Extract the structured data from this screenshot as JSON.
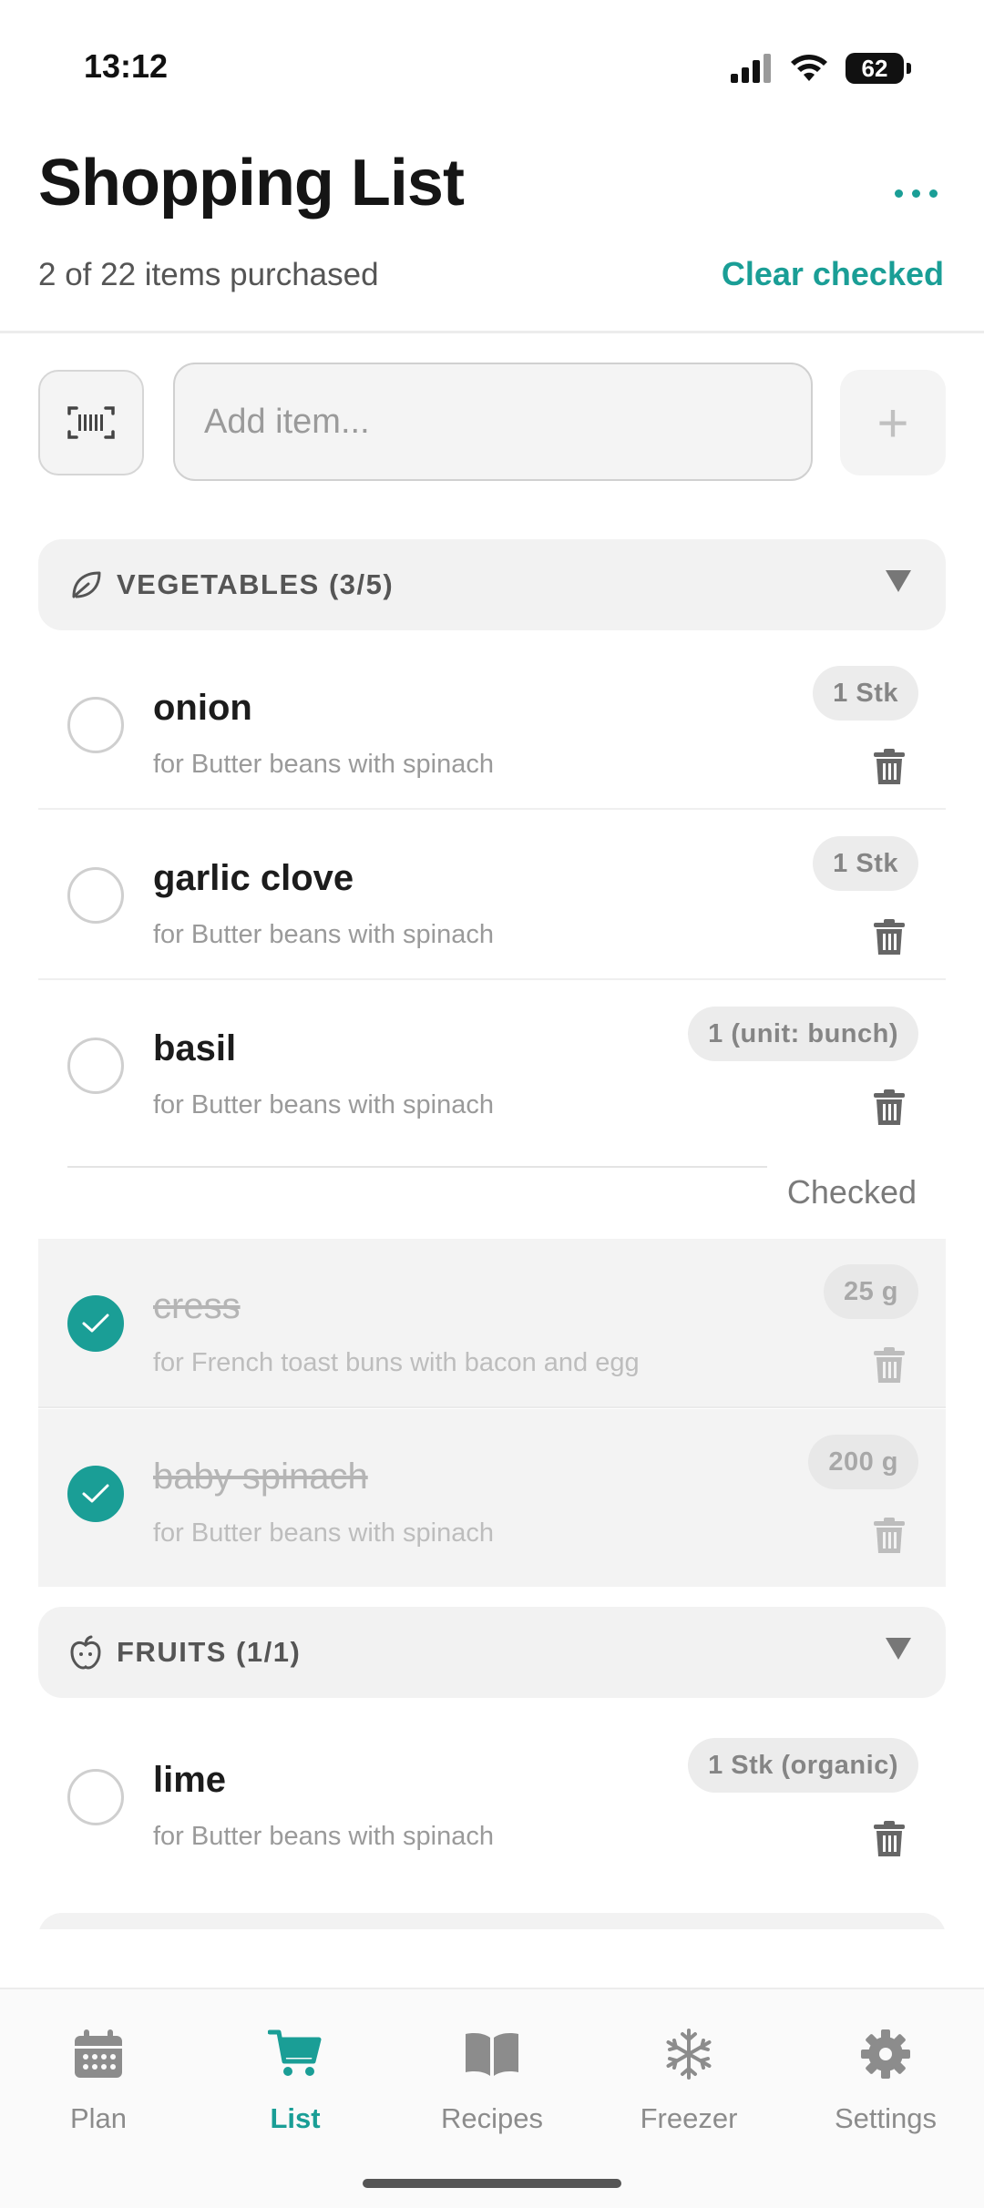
{
  "status_bar": {
    "time": "13:12",
    "battery": "62"
  },
  "header": {
    "title": "Shopping List",
    "subtitle": "2 of 22 items purchased",
    "clear_label": "Clear checked"
  },
  "add_item": {
    "placeholder": "Add item...",
    "add_symbol": "+"
  },
  "categories": [
    {
      "label": "VEGETABLES (3/5)",
      "icon": "leaf-icon",
      "items": [
        {
          "name": "onion",
          "note": "for Butter beans with spinach",
          "qty": "1 Stk",
          "checked": false
        },
        {
          "name": "garlic clove",
          "note": "for Butter beans with spinach",
          "qty": "1 Stk",
          "checked": false
        },
        {
          "name": "basil",
          "note": "for Butter beans with spinach",
          "qty": "1 (unit: bunch)",
          "checked": false
        }
      ],
      "checked_label": "Checked",
      "checked_items": [
        {
          "name": "cress",
          "note": "for French toast buns with bacon and egg",
          "qty": "25 g",
          "checked": true
        },
        {
          "name": "baby spinach",
          "note": "for Butter beans with spinach",
          "qty": "200 g",
          "checked": true
        }
      ]
    },
    {
      "label": "FRUITS (1/1)",
      "icon": "apple-icon",
      "items": [
        {
          "name": "lime",
          "note": "for Butter beans with spinach",
          "qty": "1 Stk (organic)",
          "checked": false
        }
      ]
    }
  ],
  "nav": [
    {
      "label": "Plan",
      "icon": "calendar-icon",
      "active": false
    },
    {
      "label": "List",
      "icon": "cart-icon",
      "active": true
    },
    {
      "label": "Recipes",
      "icon": "book-icon",
      "active": false
    },
    {
      "label": "Freezer",
      "icon": "snowflake-icon",
      "active": false
    },
    {
      "label": "Settings",
      "icon": "gear-icon",
      "active": false
    }
  ],
  "colors": {
    "accent": "#1a9e96",
    "muted": "#8c8c8c"
  }
}
